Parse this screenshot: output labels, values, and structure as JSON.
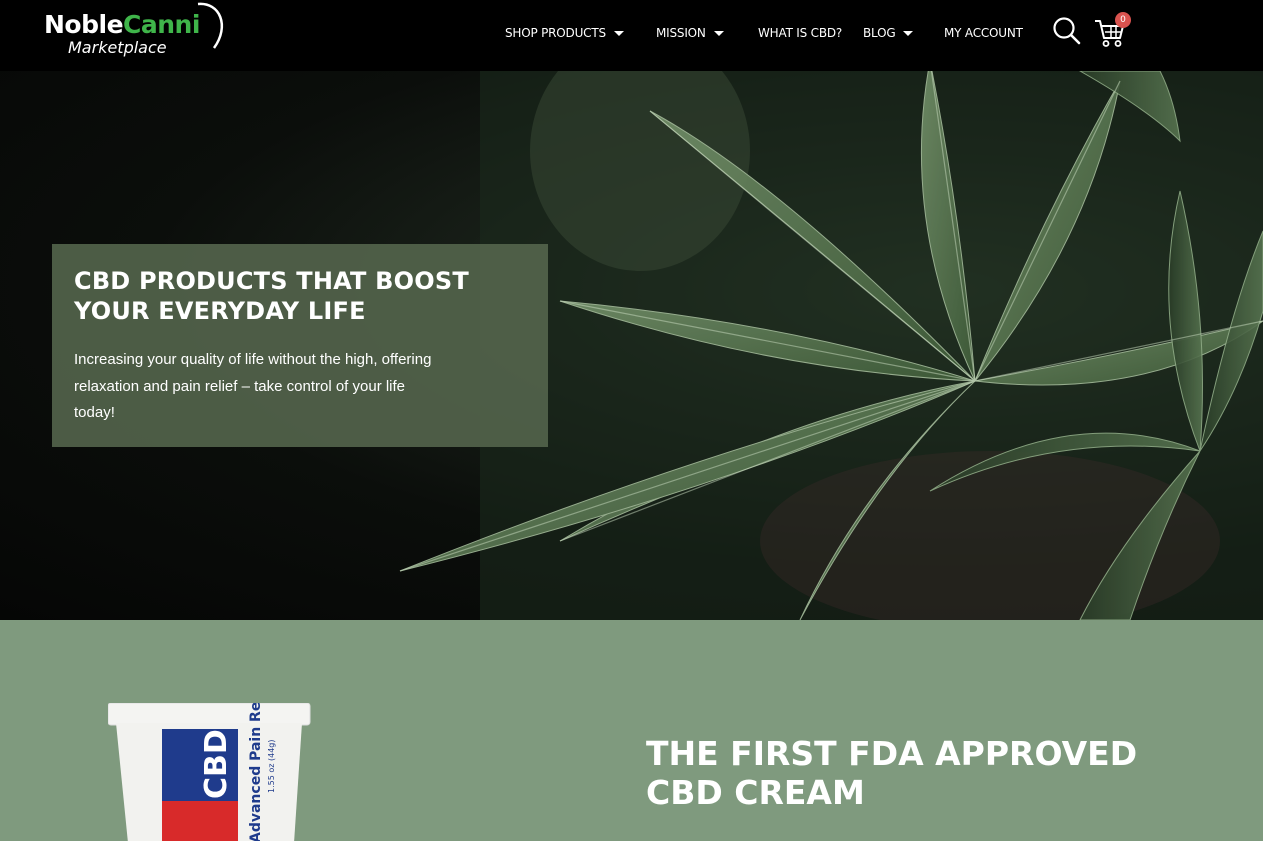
{
  "header": {
    "logo_noble": "Noble",
    "logo_canni": "Canni",
    "logo_marketplace": "Marketplace",
    "nav": [
      {
        "label": "SHOP PRODUCTS",
        "has_dropdown": true
      },
      {
        "label": "MISSION",
        "has_dropdown": true
      },
      {
        "label": "WHAT IS CBD?",
        "has_dropdown": false
      },
      {
        "label": "BLOG",
        "has_dropdown": true
      },
      {
        "label": "MY ACCOUNT",
        "has_dropdown": false
      }
    ],
    "search_icon": "search-icon",
    "cart_icon": "cart-icon",
    "cart_count": "0"
  },
  "hero": {
    "title": "CBD PRODUCTS THAT BOOST YOUR EVERYDAY LIFE",
    "text": "Increasing your quality of life without the high, offering relaxation and pain relief – take control of your life today!"
  },
  "featured": {
    "title": "THE FIRST FDA APPROVED CBD CREAM",
    "product_label_brand": "CBD",
    "product_label_desc": "Advanced Pain Relief",
    "product_label_size": "1.55 oz (44g)"
  },
  "colors": {
    "header_bg": "#000000",
    "hero_box": "#52634b",
    "section_bg": "#7f9a7e",
    "accent_green": "#3fb54a",
    "badge": "#d9534f"
  }
}
